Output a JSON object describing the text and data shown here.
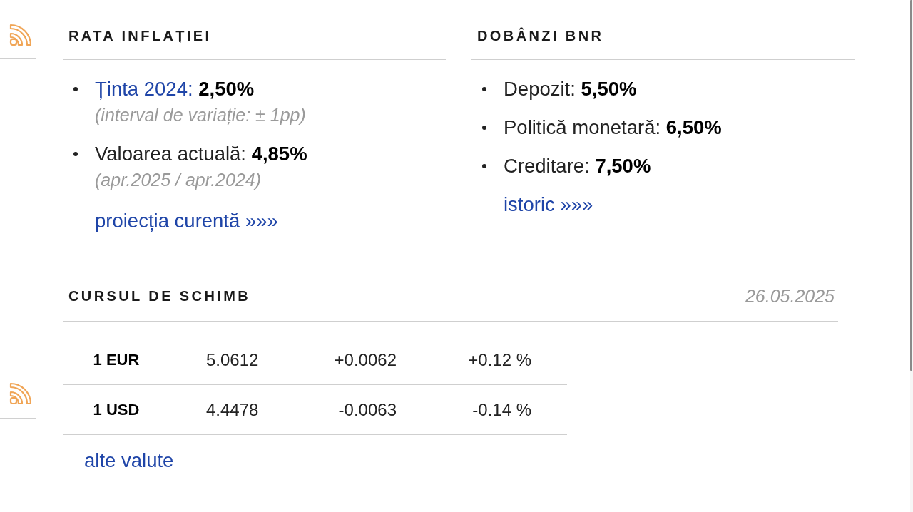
{
  "inflation": {
    "title": "RATA INFLAȚIEI",
    "items": [
      {
        "kind": "link",
        "label": "Ținta 2024:",
        "value": "2,50%",
        "note": "(interval de variație: ± 1pp)"
      },
      {
        "kind": "text",
        "label": "Valoarea actuală:",
        "value": "4,85%",
        "note": "(apr.2025 / apr.2024)"
      }
    ],
    "link": "proiecția curentă »»»"
  },
  "interest_rates": {
    "title": "DOBÂNZI BNR",
    "items": [
      {
        "label": "Depozit:",
        "value": "5,50%"
      },
      {
        "label": "Politică monetară:",
        "value": "6,50%"
      },
      {
        "label": "Creditare:",
        "value": "7,50%"
      }
    ],
    "link": "istoric »»»"
  },
  "exchange_rates": {
    "title": "CURSUL DE SCHIMB",
    "date": "26.05.2025",
    "rows": [
      {
        "currency": "1 EUR",
        "rate": "5.0612",
        "change": "+0.0062",
        "change_percent": "+0.12 %"
      },
      {
        "currency": "1 USD",
        "rate": "4.4478",
        "change": "-0.0063",
        "change_percent": "-0.14 %"
      }
    ],
    "link": "alte valute"
  }
}
